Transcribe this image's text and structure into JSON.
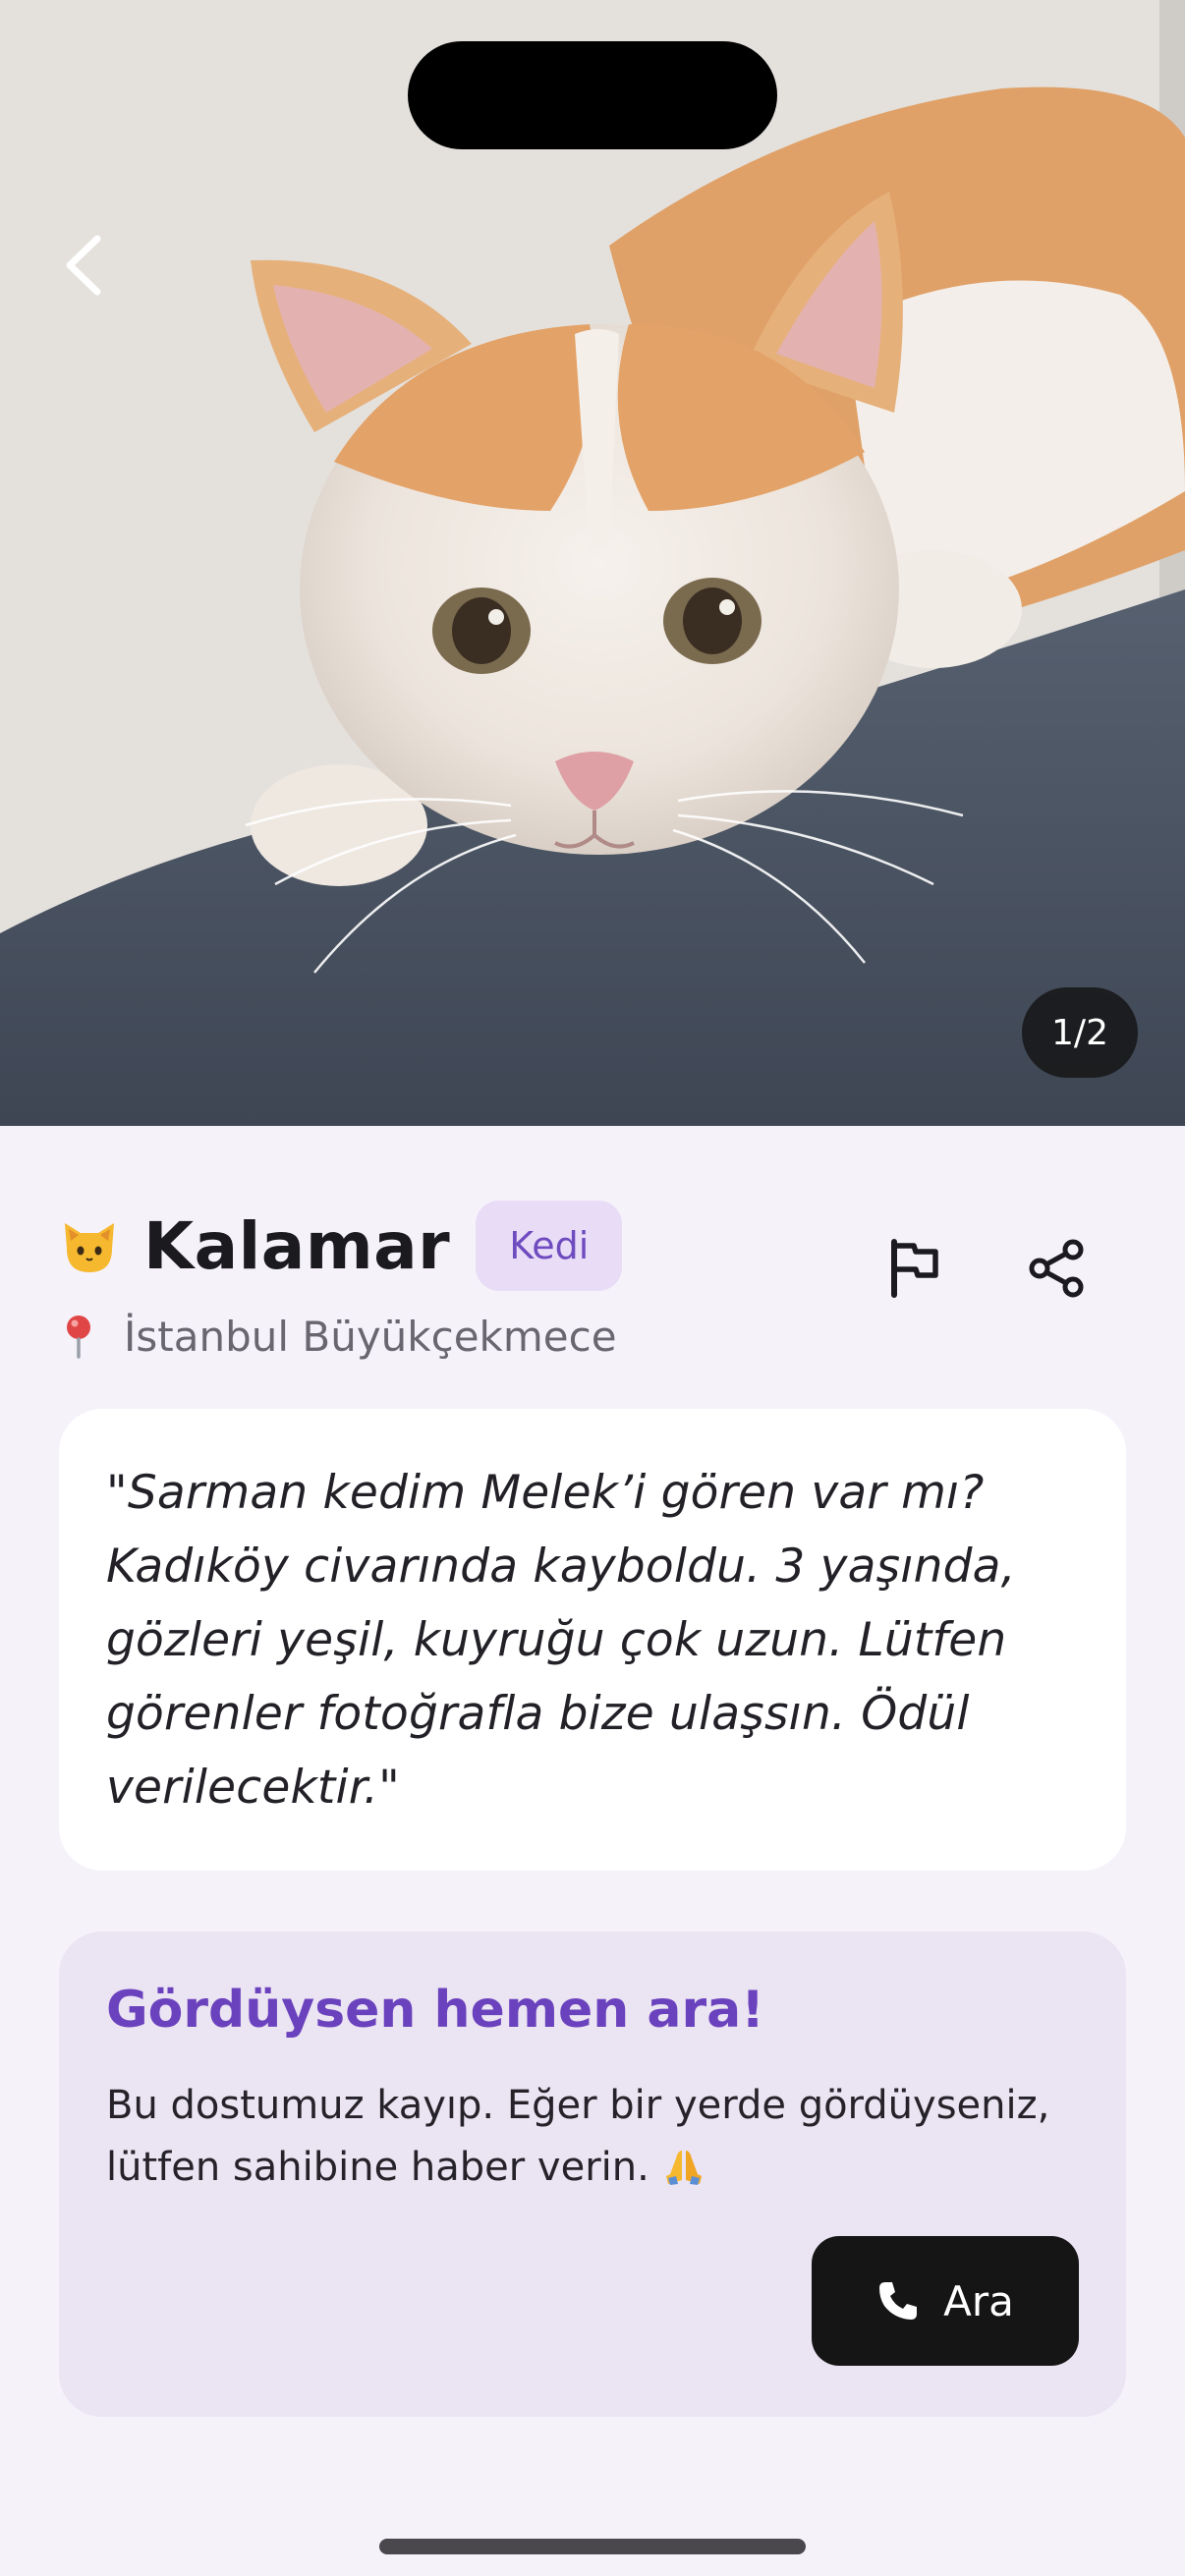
{
  "hero": {
    "image_counter": "1/2"
  },
  "pet": {
    "emoji_icon": "cat-face-icon",
    "name": "Kalamar",
    "type_badge": "Kedi",
    "location_icon": "pin-icon",
    "location": "İstanbul Büyükçekmece"
  },
  "actions": {
    "report_icon": "flag-icon",
    "share_icon": "share-icon"
  },
  "description": {
    "quote": "\"Sarman kedim Melek’i gören var mı? Kadıköy civarında kayboldu. 3 yaşında, gözleri yeşil, kuyruğu çok uzun. Lütfen görenler fotoğrafla bize ulaşsın. Ödül verilecektir.\""
  },
  "alert": {
    "title": "Gördüysen hemen ara!",
    "body": "Bu dostumuz kayıp. Eğer bir yerde gördüyseniz, lütfen sahibine haber verin.",
    "call_label": "Ara"
  },
  "colors": {
    "accent": "#6b42bd",
    "badge_bg": "#e8dcf6",
    "alert_bg": "#ebe4f3",
    "page_bg": "#f5f2fa",
    "button_dark": "#151515"
  }
}
